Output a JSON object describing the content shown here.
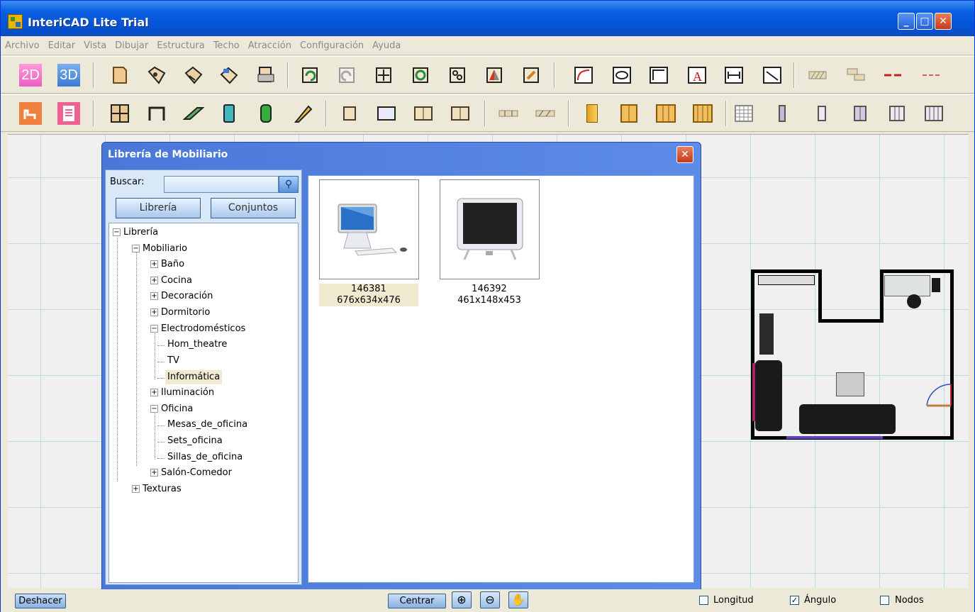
{
  "window": {
    "title": "InteriCAD Lite Trial",
    "controls": {
      "minimize": "_",
      "maximize": "□",
      "close": "✕"
    }
  },
  "menu": [
    "Archivo",
    "Editar",
    "Vista",
    "Dibujar",
    "Estructura",
    "Techo",
    "Atracción",
    "Configuración",
    "Ayuda"
  ],
  "toolbar1": {
    "view_2d": "2D",
    "view_3d": "3D",
    "icons": [
      "new-file",
      "open-file",
      "save-file",
      "save-as",
      "print",
      "undo",
      "redo",
      "move",
      "rotate",
      "copy",
      "mirror",
      "edit",
      "arc-wall",
      "circle-area",
      "corner-area",
      "text",
      "dimension",
      "angle-measure",
      "hatch-1",
      "hatch-2",
      "line-red",
      "line-dashed-red"
    ]
  },
  "toolbar2": {
    "icons": [
      "furniture-library",
      "material-library",
      "floor-plan",
      "room",
      "beam",
      "column",
      "cylinder",
      "stair-pencil",
      "door-single",
      "window-plain",
      "double-window",
      "double-panel",
      "wall-opening",
      "wall-opening-2",
      "door-tall",
      "double-door",
      "triple-door",
      "quad-door",
      "grid-window",
      "door-narrow",
      "door-frame",
      "door-double-frame",
      "shelf-3",
      "shelf-4"
    ]
  },
  "dialog": {
    "title": "Librería de Mobiliario",
    "close": "✕",
    "search_label": "Buscar:",
    "search_value": "",
    "search_icon": "⚲",
    "tab_library": "Librería",
    "tab_sets": "Conjuntos",
    "tree": [
      {
        "label": "Librería",
        "exp": "−",
        "level": 0
      },
      {
        "label": "Mobiliario",
        "exp": "−",
        "level": 1
      },
      {
        "label": "Baño",
        "exp": "+",
        "level": 2
      },
      {
        "label": "Cocina",
        "exp": "+",
        "level": 2
      },
      {
        "label": "Decoración",
        "exp": "+",
        "level": 2
      },
      {
        "label": "Dormitorio",
        "exp": "+",
        "level": 2
      },
      {
        "label": "Electrodomésticos",
        "exp": "−",
        "level": 2
      },
      {
        "label": "Hom_theatre",
        "exp": "",
        "level": 3
      },
      {
        "label": "TV",
        "exp": "",
        "level": 3
      },
      {
        "label": "Informática",
        "exp": "",
        "level": 3,
        "selected": true
      },
      {
        "label": "Iluminación",
        "exp": "+",
        "level": 2
      },
      {
        "label": "Oficina",
        "exp": "−",
        "level": 2
      },
      {
        "label": "Mesas_de_oficina",
        "exp": "",
        "level": 3
      },
      {
        "label": "Sets_oficina",
        "exp": "",
        "level": 3
      },
      {
        "label": "Sillas_de_oficina",
        "exp": "",
        "level": 3
      },
      {
        "label": "Salón-Comedor",
        "exp": "+",
        "level": 2
      },
      {
        "label": "Texturas",
        "exp": "+",
        "level": 1
      }
    ],
    "items": [
      {
        "id": "146381",
        "dims": "676x634x476",
        "selected": true
      },
      {
        "id": "146392",
        "dims": "461x148x453",
        "selected": false
      }
    ]
  },
  "status": {
    "undo": "Deshacer",
    "center": "Centrar",
    "zoom_in_icon": "⊕",
    "zoom_out_icon": "⊖",
    "pan_icon": "✋",
    "length_label": "Longitud",
    "length_checked": false,
    "angle_label": "Ángulo",
    "angle_checked": true,
    "nodes_label": "Nodos",
    "nodes_checked": false,
    "check_mark": "✓"
  },
  "colors": {
    "titlebar": "#0553d6",
    "dialog_frame": "#5c8ce8",
    "grid_line": "#b6dede"
  }
}
